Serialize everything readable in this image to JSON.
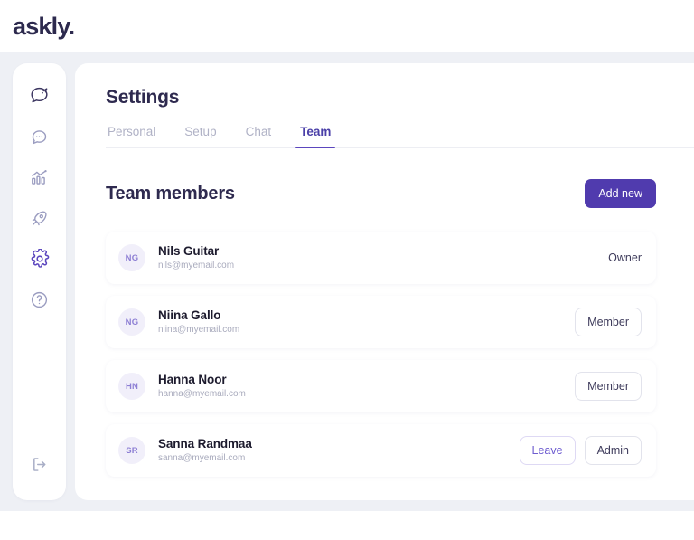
{
  "brand": {
    "logo_text": "askly",
    "logo_dot": "."
  },
  "sidebar": {
    "items": [
      {
        "icon": "askly-bird-logo-icon",
        "label": "Askly"
      },
      {
        "icon": "chat-bubble-icon",
        "label": "Chat"
      },
      {
        "icon": "analytics-bar-chart-icon",
        "label": "Statistics"
      },
      {
        "icon": "rocket-icon",
        "label": "Campaigns"
      },
      {
        "icon": "gear-icon",
        "label": "Settings",
        "active": true
      },
      {
        "icon": "help-circle-icon",
        "label": "Help"
      }
    ],
    "bottom": {
      "icon": "logout-icon",
      "label": "Log out"
    }
  },
  "header": {
    "title": "Settings"
  },
  "tabs": [
    {
      "label": "Personal",
      "active": false
    },
    {
      "label": "Setup",
      "active": false
    },
    {
      "label": "Chat",
      "active": false
    },
    {
      "label": "Team",
      "active": true
    }
  ],
  "team": {
    "section_title": "Team members",
    "add_button": "Add new",
    "members": [
      {
        "initials": "NG",
        "name": "Nils Guitar",
        "email": "nils@myemail.com",
        "role_label": "Owner",
        "role_style": "plain"
      },
      {
        "initials": "NG",
        "name": "Niina Gallo",
        "email": "niina@myemail.com",
        "role_label": "Member",
        "role_style": "outline"
      },
      {
        "initials": "HN",
        "name": "Hanna Noor",
        "email": "hanna@myemail.com",
        "role_label": "Member",
        "role_style": "outline"
      },
      {
        "initials": "SR",
        "name": "Sanna Randmaa",
        "email": "sanna@myemail.com",
        "leave_label": "Leave",
        "role_label": "Admin",
        "role_style": "outline-with-leave"
      }
    ]
  },
  "colors": {
    "accent": "#503bae",
    "accent_light": "#6f5ed0",
    "page_background": "#eef0f5",
    "text_dark": "#2e2a4f",
    "text_muted": "#a9abbd",
    "avatar_bg": "#f1effa"
  }
}
